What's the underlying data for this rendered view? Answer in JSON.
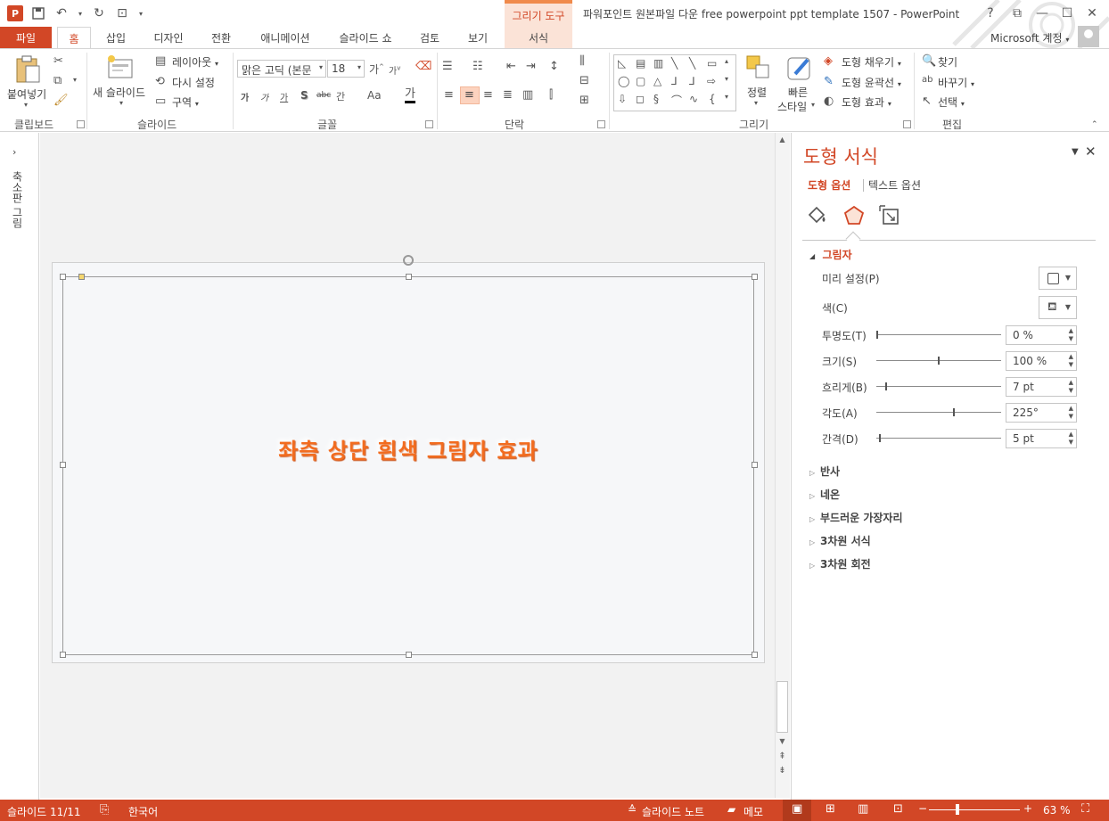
{
  "app": {
    "window_title": "파워포인트 원본파일 다운 free powerpoint ppt template 1507 - PowerPoint",
    "context_tab_title": "그리기 도구",
    "account": "Microsoft 계정",
    "brand_color": "#d24726"
  },
  "ribbon_tabs": [
    "파일",
    "홈",
    "삽입",
    "디자인",
    "전환",
    "애니메이션",
    "슬라이드 쇼",
    "검토",
    "보기",
    "서식"
  ],
  "ribbon": {
    "clipboard": {
      "paste": "붙여넣기",
      "label": "클립보드"
    },
    "slides": {
      "new_slide": "새 슬라이드",
      "layout": "레이아웃",
      "reset": "다시 설정",
      "section": "구역",
      "label": "슬라이드"
    },
    "font": {
      "font_name": "맑은 고딕 (본문",
      "font_size": "18",
      "label": "글꼴",
      "bold": "가",
      "italic": "가",
      "underline": "가",
      "shadow": "S",
      "strike": "abc",
      "spacing": "간",
      "case": "Aa",
      "color": "가"
    },
    "paragraph": {
      "label": "단락"
    },
    "drawing": {
      "arrange": "정렬",
      "quick_styles_1": "빠른",
      "quick_styles_2": "스타일",
      "fill": "도형 채우기",
      "outline": "도형 윤곽선",
      "effects": "도형 효과",
      "label": "그리기"
    },
    "editing": {
      "find": "찾기",
      "replace": "바꾸기",
      "select": "선택",
      "label": "편집"
    }
  },
  "left_pane": {
    "label": "축소판 그림"
  },
  "slide": {
    "text": "좌측 상단 흰색 그림자 효과",
    "text_color": "#f26c1f"
  },
  "format_pane": {
    "title": "도형 서식",
    "subtab_shape": "도형 옵션",
    "subtab_text": "텍스트 옵션",
    "section_shadow": "그림자",
    "props": {
      "preset": "미리 설정(P)",
      "color": "색(C)",
      "transparency": {
        "label": "투명도(T)",
        "value": "0 %",
        "level": 0
      },
      "size": {
        "label": "크기(S)",
        "value": "100 %",
        "level": 0.5
      },
      "blur": {
        "label": "흐리게(B)",
        "value": "7 pt",
        "level": 0.07
      },
      "angle": {
        "label": "각도(A)",
        "value": "225°",
        "level": 0.625
      },
      "distance": {
        "label": "간격(D)",
        "value": "5 pt",
        "level": 0.025
      }
    },
    "sections": [
      "반사",
      "네온",
      "부드러운 가장자리",
      "3차원 서식",
      "3차원 회전"
    ]
  },
  "status": {
    "slide_count": "슬라이드 11/11",
    "language": "한국어",
    "notes": "슬라이드 노트",
    "comments": "메모",
    "zoom": "63 %",
    "zoom_level": 0.3
  }
}
